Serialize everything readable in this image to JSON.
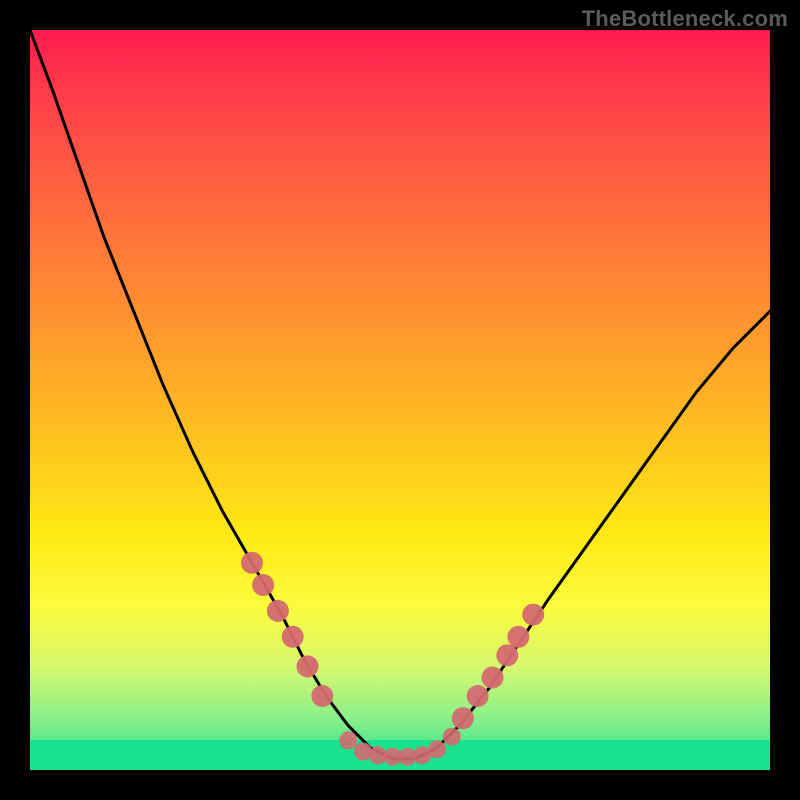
{
  "watermark": "TheBottleneck.com",
  "chart_data": {
    "type": "line",
    "title": "",
    "xlabel": "",
    "ylabel": "",
    "x_range": [
      0,
      100
    ],
    "y_range": [
      0,
      100
    ],
    "grid": false,
    "legend": false,
    "background": {
      "style": "vertical-gradient",
      "stops": [
        {
          "pos": 0.0,
          "color": "#ff1a4d"
        },
        {
          "pos": 0.22,
          "color": "#ff643f"
        },
        {
          "pos": 0.55,
          "color": "#ffc21f"
        },
        {
          "pos": 0.78,
          "color": "#fafc3d"
        },
        {
          "pos": 0.93,
          "color": "#8af08a"
        },
        {
          "pos": 1.0,
          "color": "#1de08a"
        }
      ]
    },
    "series": [
      {
        "name": "bottleneck-curve",
        "style": "line",
        "color": "#000000",
        "x": [
          0.0,
          3.0,
          6.5,
          10.0,
          14.0,
          18.0,
          22.0,
          26.0,
          30.0,
          34.0,
          37.0,
          40.0,
          43.0,
          46.0,
          49.0,
          52.0,
          55.0,
          58.0,
          62.0,
          66.0,
          70.0,
          75.0,
          80.0,
          85.0,
          90.0,
          95.0,
          100.0
        ],
        "y": [
          100.0,
          92.0,
          82.0,
          72.0,
          62.0,
          52.0,
          43.0,
          35.0,
          28.0,
          21.0,
          15.0,
          10.0,
          6.0,
          3.0,
          1.5,
          1.5,
          3.0,
          6.0,
          11.0,
          17.0,
          23.0,
          30.0,
          37.0,
          44.0,
          51.0,
          57.0,
          62.0
        ]
      },
      {
        "name": "highlight-points-left",
        "style": "scatter",
        "color": "#d46a70",
        "x": [
          30.0,
          31.5,
          33.5,
          35.5,
          37.5,
          39.5
        ],
        "y": [
          28.0,
          25.0,
          21.5,
          18.0,
          14.0,
          10.0
        ]
      },
      {
        "name": "highlight-points-right",
        "style": "scatter",
        "color": "#d46a70",
        "x": [
          58.5,
          60.5,
          62.5,
          64.5,
          66.0,
          68.0
        ],
        "y": [
          7.0,
          10.0,
          12.5,
          15.5,
          18.0,
          21.0
        ]
      },
      {
        "name": "highlight-points-bottom",
        "style": "scatter",
        "color": "#d46a70",
        "x": [
          43.0,
          45.0,
          47.0,
          49.0,
          51.0,
          53.0,
          55.0,
          57.0
        ],
        "y": [
          4.0,
          2.5,
          2.0,
          1.8,
          1.8,
          2.0,
          2.8,
          4.5
        ]
      }
    ],
    "annotations": [
      {
        "text": "TheBottleneck.com",
        "position": "top-right",
        "role": "watermark"
      }
    ]
  }
}
